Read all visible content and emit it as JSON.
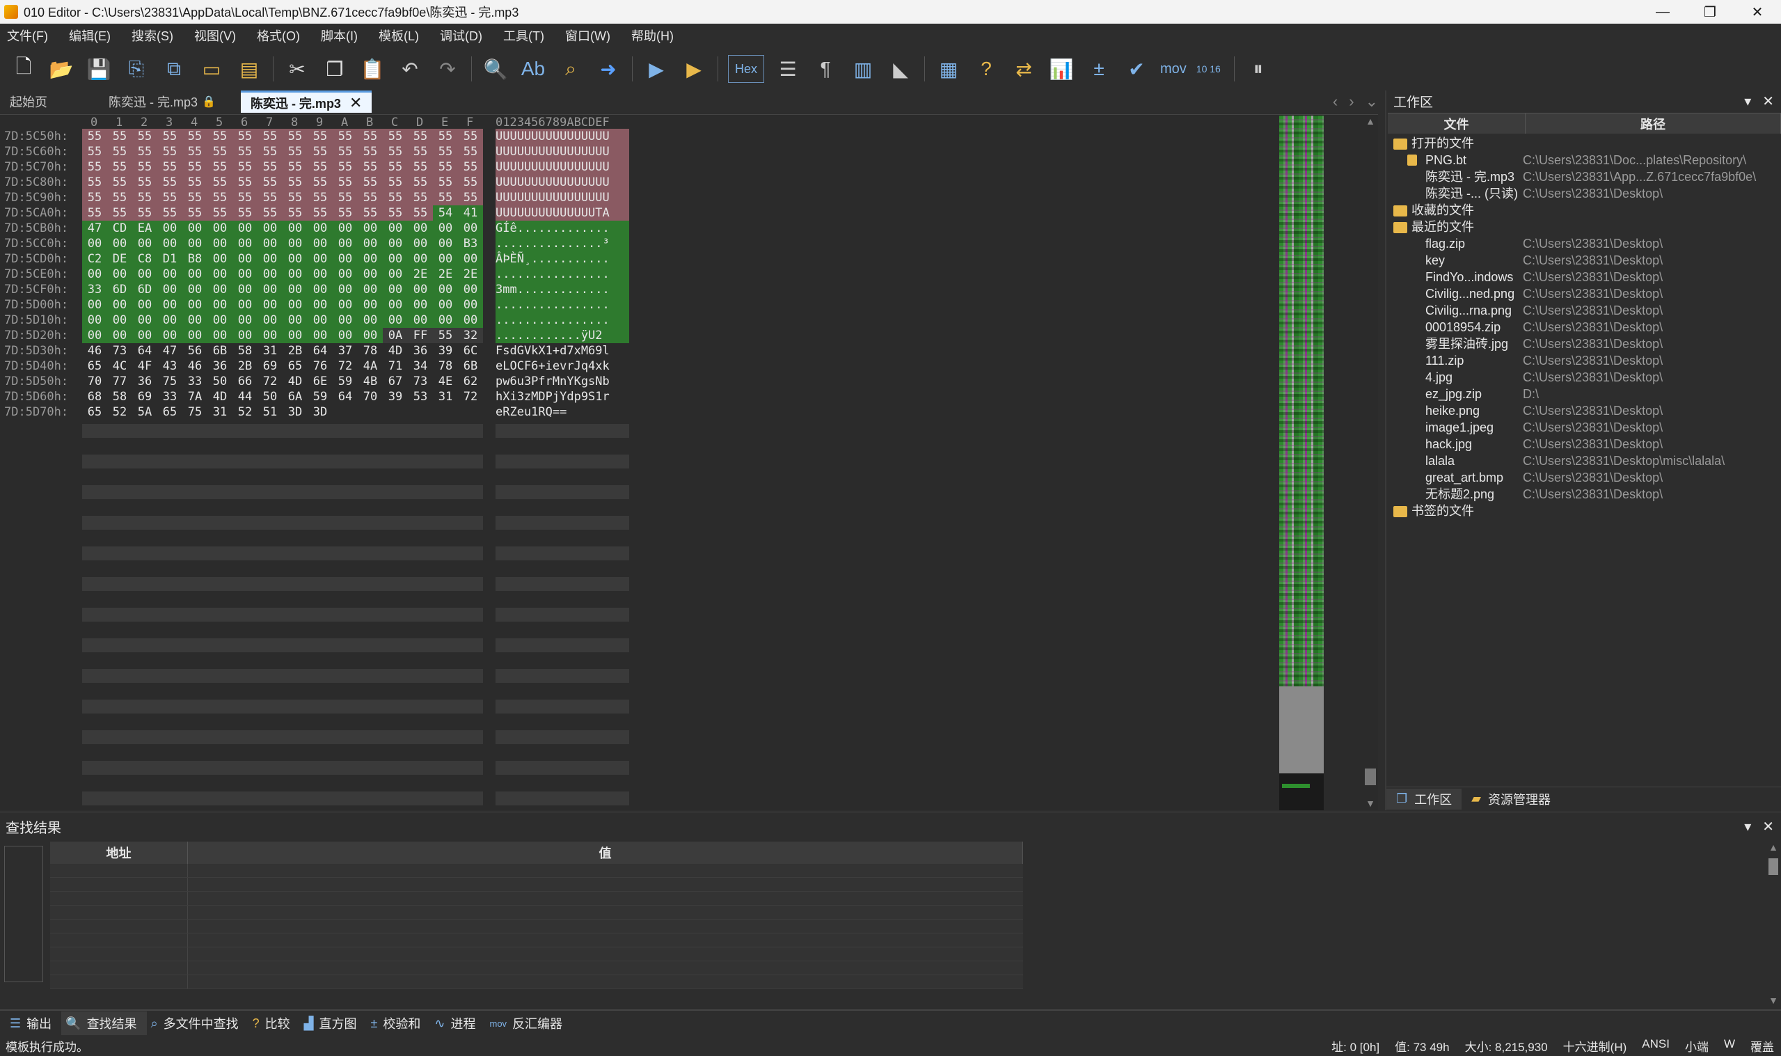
{
  "titlebar": {
    "title": "010 Editor - C:\\Users\\23831\\AppData\\Local\\Temp\\BNZ.671cecc7fa9bf0e\\陈奕迅 - 完.mp3",
    "minimize": "—",
    "maximize": "❐",
    "close": "✕"
  },
  "menu": [
    "文件(F)",
    "编辑(E)",
    "搜索(S)",
    "视图(V)",
    "格式(O)",
    "脚本(I)",
    "模板(L)",
    "调试(D)",
    "工具(T)",
    "窗口(W)",
    "帮助(H)"
  ],
  "toolbar": {
    "hex_label": "Hex",
    "mov_label": "mov",
    "base_label": "10 16"
  },
  "tabs": {
    "start": "起始页",
    "file1": "陈奕迅 - 完.mp3",
    "file2": "陈奕迅 - 完.mp3"
  },
  "hex": {
    "column_header": [
      "0",
      "1",
      "2",
      "3",
      "4",
      "5",
      "6",
      "7",
      "8",
      "9",
      "A",
      "B",
      "C",
      "D",
      "E",
      "F"
    ],
    "ascii_header": "0123456789ABCDEF",
    "rows": [
      {
        "addr": "7D:5C50h:",
        "bytes": [
          "55",
          "55",
          "55",
          "55",
          "55",
          "55",
          "55",
          "55",
          "55",
          "55",
          "55",
          "55",
          "55",
          "55",
          "55",
          "55"
        ],
        "ascii": "UUUUUUUUUUUUUUUU"
      },
      {
        "addr": "7D:5C60h:",
        "bytes": [
          "55",
          "55",
          "55",
          "55",
          "55",
          "55",
          "55",
          "55",
          "55",
          "55",
          "55",
          "55",
          "55",
          "55",
          "55",
          "55"
        ],
        "ascii": "UUUUUUUUUUUUUUUU"
      },
      {
        "addr": "7D:5C70h:",
        "bytes": [
          "55",
          "55",
          "55",
          "55",
          "55",
          "55",
          "55",
          "55",
          "55",
          "55",
          "55",
          "55",
          "55",
          "55",
          "55",
          "55"
        ],
        "ascii": "UUUUUUUUUUUUUUUU"
      },
      {
        "addr": "7D:5C80h:",
        "bytes": [
          "55",
          "55",
          "55",
          "55",
          "55",
          "55",
          "55",
          "55",
          "55",
          "55",
          "55",
          "55",
          "55",
          "55",
          "55",
          "55"
        ],
        "ascii": "UUUUUUUUUUUUUUUU"
      },
      {
        "addr": "7D:5C90h:",
        "bytes": [
          "55",
          "55",
          "55",
          "55",
          "55",
          "55",
          "55",
          "55",
          "55",
          "55",
          "55",
          "55",
          "55",
          "55",
          "55",
          "55"
        ],
        "ascii": "UUUUUUUUUUUUUUUU"
      },
      {
        "addr": "7D:5CA0h:",
        "bytes": [
          "55",
          "55",
          "55",
          "55",
          "55",
          "55",
          "55",
          "55",
          "55",
          "55",
          "55",
          "55",
          "55",
          "55",
          "54",
          "41"
        ],
        "ascii": "UUUUUUUUUUUUUUTA"
      },
      {
        "addr": "7D:5CB0h:",
        "bytes": [
          "47",
          "CD",
          "EA",
          "00",
          "00",
          "00",
          "00",
          "00",
          "00",
          "00",
          "00",
          "00",
          "00",
          "00",
          "00",
          "00"
        ],
        "ascii": "GÍê............."
      },
      {
        "addr": "7D:5CC0h:",
        "bytes": [
          "00",
          "00",
          "00",
          "00",
          "00",
          "00",
          "00",
          "00",
          "00",
          "00",
          "00",
          "00",
          "00",
          "00",
          "00",
          "B3"
        ],
        "ascii": "...............³"
      },
      {
        "addr": "7D:5CD0h:",
        "bytes": [
          "C2",
          "DE",
          "C8",
          "D1",
          "B8",
          "00",
          "00",
          "00",
          "00",
          "00",
          "00",
          "00",
          "00",
          "00",
          "00",
          "00"
        ],
        "ascii": "ÂÞÈÑ¸..........."
      },
      {
        "addr": "7D:5CE0h:",
        "bytes": [
          "00",
          "00",
          "00",
          "00",
          "00",
          "00",
          "00",
          "00",
          "00",
          "00",
          "00",
          "00",
          "00",
          "2E",
          "2E",
          "2E"
        ],
        "ascii": "................"
      },
      {
        "addr": "7D:5CF0h:",
        "bytes": [
          "33",
          "6D",
          "6D",
          "00",
          "00",
          "00",
          "00",
          "00",
          "00",
          "00",
          "00",
          "00",
          "00",
          "00",
          "00",
          "00"
        ],
        "ascii": "3mm............."
      },
      {
        "addr": "7D:5D00h:",
        "bytes": [
          "00",
          "00",
          "00",
          "00",
          "00",
          "00",
          "00",
          "00",
          "00",
          "00",
          "00",
          "00",
          "00",
          "00",
          "00",
          "00"
        ],
        "ascii": "................"
      },
      {
        "addr": "7D:5D10h:",
        "bytes": [
          "00",
          "00",
          "00",
          "00",
          "00",
          "00",
          "00",
          "00",
          "00",
          "00",
          "00",
          "00",
          "00",
          "00",
          "00",
          "00"
        ],
        "ascii": "................"
      },
      {
        "addr": "7D:5D20h:",
        "bytes": [
          "00",
          "00",
          "00",
          "00",
          "00",
          "00",
          "00",
          "00",
          "00",
          "00",
          "00",
          "00",
          "0A",
          "FF",
          "55",
          "32"
        ],
        "ascii": "............ÿU2"
      },
      {
        "addr": "7D:5D30h:",
        "bytes": [
          "46",
          "73",
          "64",
          "47",
          "56",
          "6B",
          "58",
          "31",
          "2B",
          "64",
          "37",
          "78",
          "4D",
          "36",
          "39",
          "6C"
        ],
        "ascii": "FsdGVkX1+d7xM69l"
      },
      {
        "addr": "7D:5D40h:",
        "bytes": [
          "65",
          "4C",
          "4F",
          "43",
          "46",
          "36",
          "2B",
          "69",
          "65",
          "76",
          "72",
          "4A",
          "71",
          "34",
          "78",
          "6B"
        ],
        "ascii": "eLOCF6+ievrJq4xk"
      },
      {
        "addr": "7D:5D50h:",
        "bytes": [
          "70",
          "77",
          "36",
          "75",
          "33",
          "50",
          "66",
          "72",
          "4D",
          "6E",
          "59",
          "4B",
          "67",
          "73",
          "4E",
          "62"
        ],
        "ascii": "pw6u3PfrMnYKgsNb"
      },
      {
        "addr": "7D:5D60h:",
        "bytes": [
          "68",
          "58",
          "69",
          "33",
          "7A",
          "4D",
          "44",
          "50",
          "6A",
          "59",
          "64",
          "70",
          "39",
          "53",
          "31",
          "72"
        ],
        "ascii": "hXi3zMDPjYdp9S1r"
      },
      {
        "addr": "7D:5D70h:",
        "bytes": [
          "65",
          "52",
          "5A",
          "65",
          "75",
          "31",
          "52",
          "51",
          "3D",
          "3D"
        ],
        "ascii": "eRZeu1RQ=="
      }
    ]
  },
  "workspace": {
    "title": "工作区",
    "col_file": "文件",
    "col_path": "路径",
    "groups": {
      "open": "打开的文件",
      "favorites": "收藏的文件",
      "recent": "最近的文件",
      "bookmarks": "书签的文件"
    },
    "open_files": [
      {
        "name": "PNG.bt",
        "path": "C:\\Users\\23831\\Doc...plates\\Repository\\"
      },
      {
        "name": "陈奕迅 - 完.mp3",
        "path": "C:\\Users\\23831\\App...Z.671cecc7fa9bf0e\\"
      },
      {
        "name": "陈奕迅 -... (只读)",
        "path": "C:\\Users\\23831\\Desktop\\"
      }
    ],
    "recent_files": [
      {
        "name": "flag.zip",
        "path": "C:\\Users\\23831\\Desktop\\"
      },
      {
        "name": "key",
        "path": "C:\\Users\\23831\\Desktop\\"
      },
      {
        "name": "FindYo...indows",
        "path": "C:\\Users\\23831\\Desktop\\"
      },
      {
        "name": "Civilig...ned.png",
        "path": "C:\\Users\\23831\\Desktop\\"
      },
      {
        "name": "Civilig...rna.png",
        "path": "C:\\Users\\23831\\Desktop\\"
      },
      {
        "name": "00018954.zip",
        "path": "C:\\Users\\23831\\Desktop\\"
      },
      {
        "name": "雾里探油砖.jpg",
        "path": "C:\\Users\\23831\\Desktop\\"
      },
      {
        "name": "111.zip",
        "path": "C:\\Users\\23831\\Desktop\\"
      },
      {
        "name": "4.jpg",
        "path": "C:\\Users\\23831\\Desktop\\"
      },
      {
        "name": "ez_jpg.zip",
        "path": "D:\\"
      },
      {
        "name": "heike.png",
        "path": "C:\\Users\\23831\\Desktop\\"
      },
      {
        "name": "image1.jpeg",
        "path": "C:\\Users\\23831\\Desktop\\"
      },
      {
        "name": "hack.jpg",
        "path": "C:\\Users\\23831\\Desktop\\"
      },
      {
        "name": "lalala",
        "path": "C:\\Users\\23831\\Desktop\\misc\\lalala\\"
      },
      {
        "name": "great_art.bmp",
        "path": "C:\\Users\\23831\\Desktop\\"
      },
      {
        "name": "无标题2.png",
        "path": "C:\\Users\\23831\\Desktop\\"
      }
    ],
    "tab_workspace": "工作区",
    "tab_explorer": "资源管理器"
  },
  "results": {
    "title": "查找结果",
    "col_address": "地址",
    "col_value": "值"
  },
  "bottom_tabs": [
    "输出",
    "查找结果",
    "多文件中查找",
    "比较",
    "直方图",
    "校验和",
    "进程",
    "反汇编器"
  ],
  "status": {
    "message": "模板执行成功。",
    "address": "址: 0 [0h]",
    "value": "值: 73 49h",
    "size": "大小: 8,215,930",
    "mode": "十六进制(H)",
    "encoding": "ANSI",
    "endian": "小端",
    "write": "W",
    "overwrite": "覆盖"
  },
  "colors": {
    "template_pink": "#8a5a62",
    "template_green": "#2e7a2e",
    "background": "#2b2b2b"
  }
}
